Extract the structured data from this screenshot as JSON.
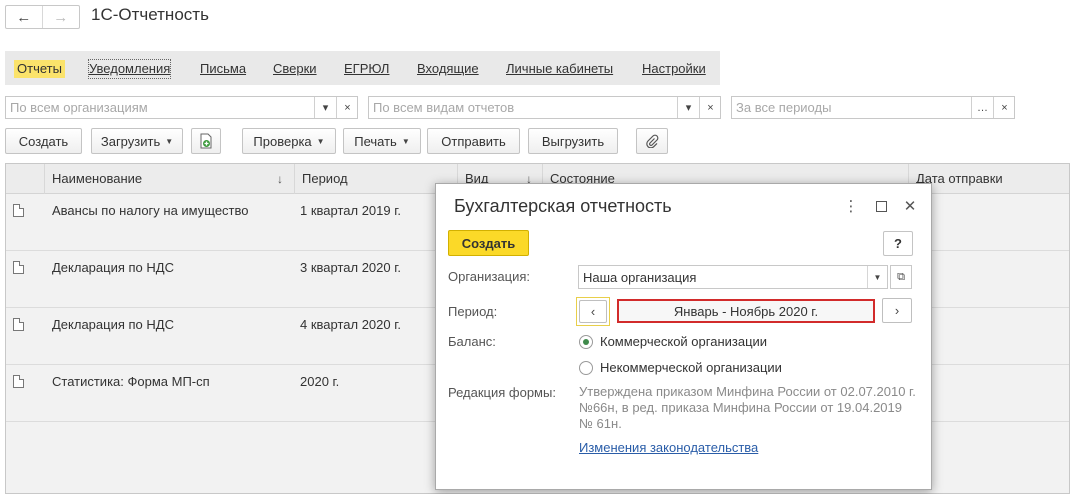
{
  "app_title": "1С-Отчетность",
  "nav": {
    "back_icon": "←",
    "forward_icon": "→"
  },
  "tabs": [
    "Отчеты",
    "Уведомления",
    "Письма",
    "Сверки",
    "ЕГРЮЛ",
    "Входящие",
    "Личные кабинеты",
    "Настройки"
  ],
  "filters": {
    "organizations_placeholder": "По всем организациям",
    "report_types_placeholder": "По всем видам отчетов",
    "periods_placeholder": "За все периоды"
  },
  "toolbar": {
    "create": "Создать",
    "load": "Загрузить",
    "check": "Проверка",
    "print": "Печать",
    "send": "Отправить",
    "export": "Выгрузить"
  },
  "grid": {
    "columns": [
      "Наименование",
      "Период",
      "Вид",
      "Состояние",
      "Дата отправки"
    ],
    "rows": [
      {
        "name": "Авансы по налогу на имущество",
        "period": "1 квартал 2019 г."
      },
      {
        "name": "Декларация по НДС",
        "period": "3 квартал 2020 г."
      },
      {
        "name": "Декларация по НДС",
        "period": "4 квартал 2020 г."
      },
      {
        "name": "Статистика: Форма МП-сп",
        "period": "2020 г."
      }
    ]
  },
  "dialog": {
    "title": "Бухгалтерская отчетность",
    "create": "Создать",
    "help": "?",
    "organization_label": "Организация:",
    "organization_value": "Наша организация",
    "period_label": "Период:",
    "period_value": "Январь - Ноябрь 2020 г.",
    "balance_label": "Баланс:",
    "balance_options": [
      "Коммерческой организации",
      "Некоммерческой организации"
    ],
    "balance_selected": "Коммерческой организации",
    "form_edition_label": "Редакция формы:",
    "form_edition_text": "Утверждена приказом Минфина России от 02.07.2010 г. №66н, в ред. приказа Минфина России от 19.04.2019 № 61н.",
    "law_changes_link": "Изменения законодательства"
  },
  "colors": {
    "accent_yellow": "#fbd928",
    "active_tab": "#fbe36b",
    "highlight_red": "#d22b2b",
    "link_blue": "#2a5da8"
  }
}
